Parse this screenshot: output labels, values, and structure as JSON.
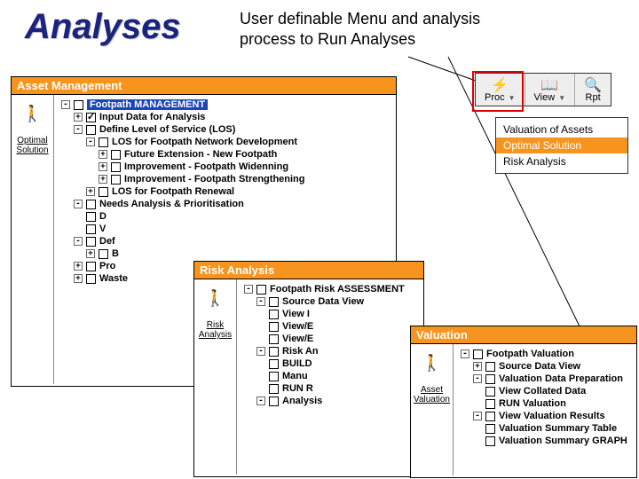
{
  "slide": {
    "title": "Analyses",
    "subtitle": "User definable Menu and analysis process  to Run Analyses"
  },
  "toolbar": {
    "proc": "Proc",
    "view": "View",
    "rpt": "Rpt"
  },
  "proc_menu": {
    "item0": "Valuation of Assets",
    "item1": "Optimal Solution",
    "item2": "Risk Analysis"
  },
  "panels": {
    "asset_mgmt": {
      "title": "Asset Management",
      "side_label": "Optimal Solution",
      "tree": {
        "n0": "Footpath MANAGEMENT",
        "n1": "Input Data for Analysis",
        "n2": "Define Level of Service (LOS)",
        "n3": "LOS for Footpath Network Development",
        "n3a": "Future Extension - New Footpath",
        "n3b": "Improvement - Footpath Widenning",
        "n3c": "Improvement - Footpath Strengthening",
        "n4": "LOS for Footpath Renewal",
        "n5": "Needs Analysis & Prioritisation",
        "n5a": "D",
        "n5b": "V",
        "n6": "Def",
        "n6a": "B",
        "n7": "Pro",
        "n8": "Waste"
      }
    },
    "risk": {
      "title": "Risk Analysis",
      "side_label": "Risk Analysis",
      "tree": {
        "n0": "Footpath Risk ASSESSMENT",
        "n1": "Source Data View",
        "n1a": "View I",
        "n1b": "View/E",
        "n1c": "View/E",
        "n2": "Risk An",
        "n2a": "BUILD",
        "n2b": "Manu",
        "n2c": "RUN R",
        "n3": "Analysis"
      }
    },
    "valuation": {
      "title": "Valuation",
      "side_label": "Asset Valuation",
      "tree": {
        "n0": "Footpath Valuation",
        "n1": "Source Data View",
        "n2": "Valuation Data Preparation",
        "n2a": "View Collated Data",
        "n2b": "RUN Valuation",
        "n3": "View Valuation Results",
        "n3a": "Valuation Summary Table",
        "n3b": "Valuation Summary GRAPH"
      }
    }
  }
}
